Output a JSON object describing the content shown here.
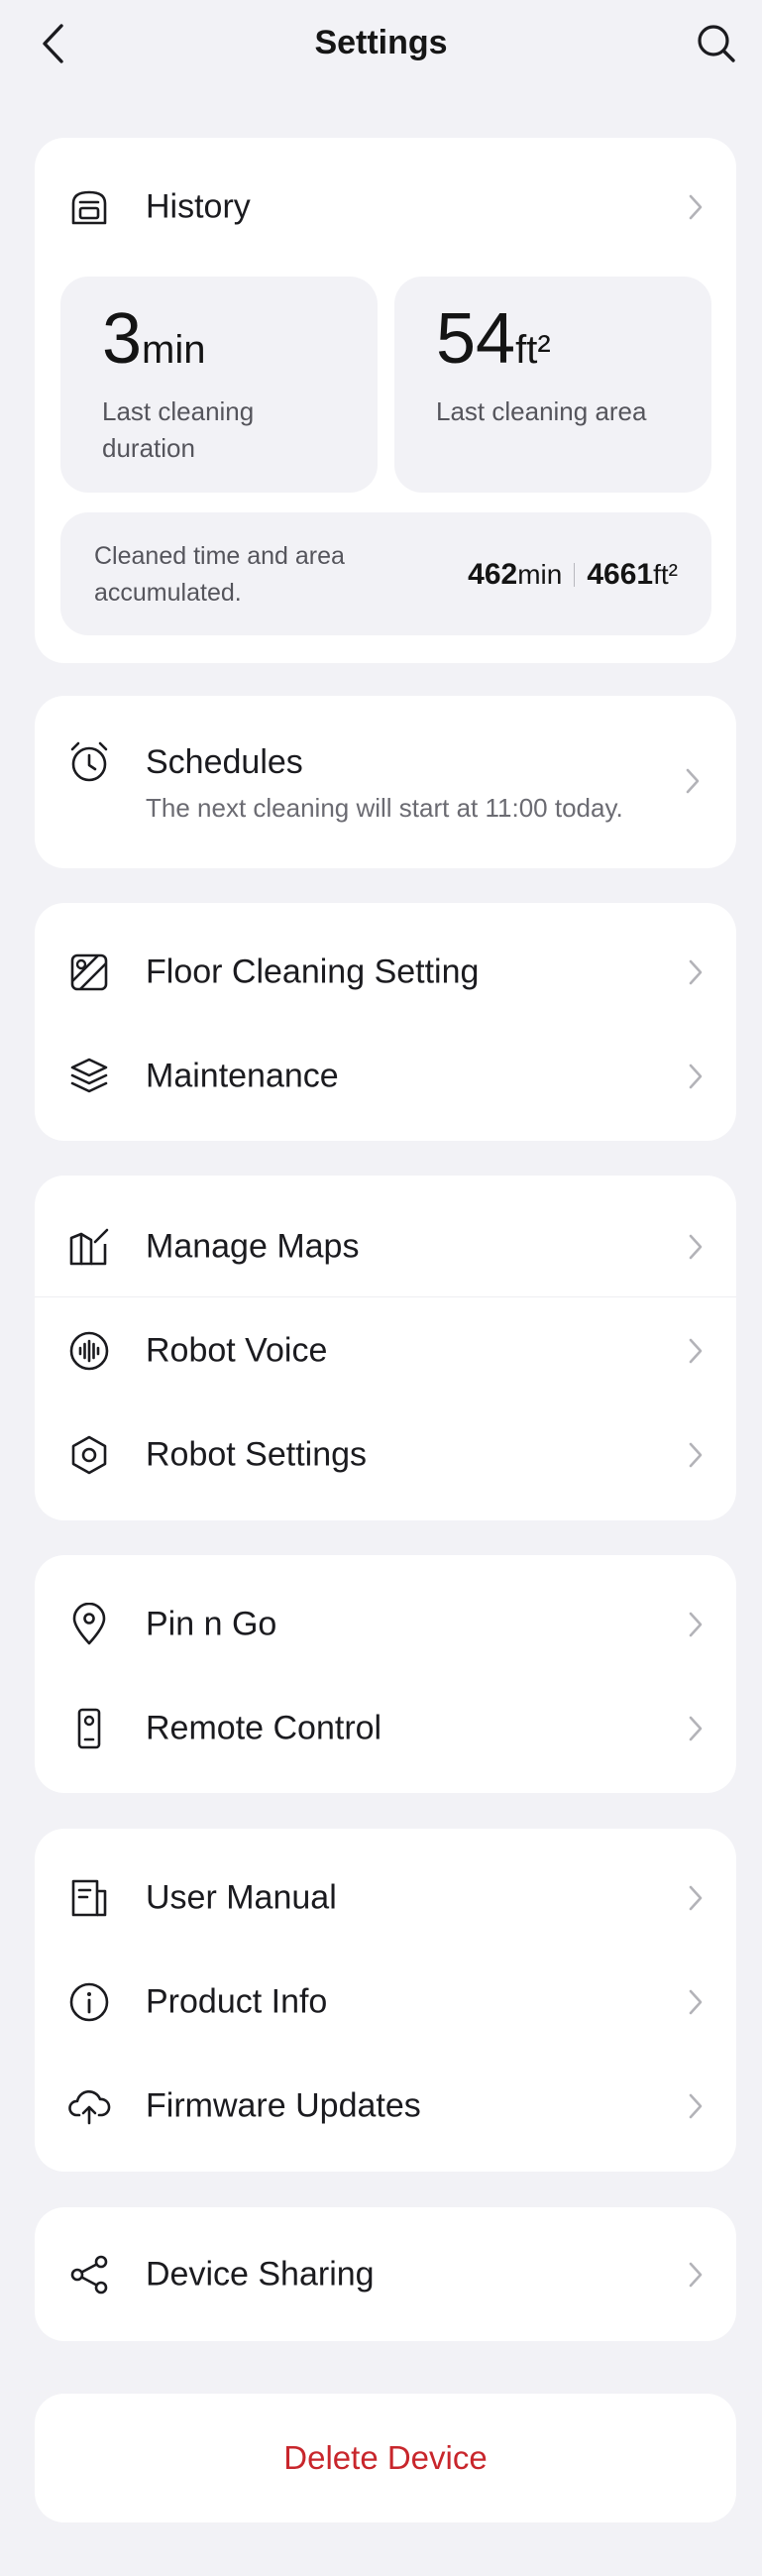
{
  "header": {
    "title": "Settings",
    "back_icon": "chevron-left-icon",
    "search_icon": "search-icon"
  },
  "history": {
    "label": "History",
    "duration": {
      "value": "3",
      "unit": "min",
      "label": "Last cleaning duration"
    },
    "area": {
      "value": "54",
      "unit": "ft²",
      "label": "Last cleaning area"
    },
    "accumulated": {
      "label": "Cleaned time and area accumulated.",
      "time_value": "462",
      "time_unit": "min",
      "area_value": "4661",
      "area_unit": "ft²"
    }
  },
  "schedules": {
    "label": "Schedules",
    "subtitle": "The next cleaning will start at 11:00 today."
  },
  "cleaning_group": {
    "floor": "Floor Cleaning Setting",
    "maintenance": "Maintenance"
  },
  "robot_group": {
    "maps": "Manage Maps",
    "voice": "Robot Voice",
    "settings": "Robot Settings"
  },
  "control_group": {
    "pin": "Pin n Go",
    "remote": "Remote Control"
  },
  "info_group": {
    "manual": "User Manual",
    "product": "Product Info",
    "firmware": "Firmware Updates"
  },
  "sharing": {
    "label": "Device Sharing"
  },
  "delete": {
    "label": "Delete Device"
  },
  "colors": {
    "background": "#f2f2f6",
    "card": "#ffffff",
    "danger": "#c8262c",
    "chevron": "#b3b3b8"
  }
}
